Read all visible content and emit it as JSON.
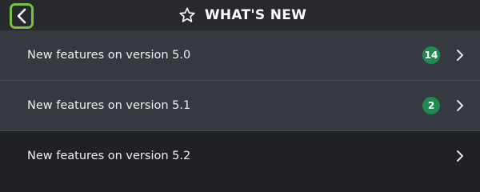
{
  "header": {
    "title": "WHAT'S NEW",
    "back_icon": "chevron-left-icon",
    "title_icon": "star-icon",
    "accent_color": "#7ac143"
  },
  "items": [
    {
      "label": "New features on version 5.0",
      "badge": "14",
      "chevron_icon": "chevron-right-icon"
    },
    {
      "label": "New features on version 5.1",
      "badge": "2",
      "chevron_icon": "chevron-right-icon"
    },
    {
      "label": "New features on version 5.2",
      "badge": "",
      "chevron_icon": "chevron-right-icon"
    }
  ],
  "colors": {
    "badge": "#1e8c50",
    "row_background": "#343a3f",
    "page_background": "#1f2124"
  }
}
